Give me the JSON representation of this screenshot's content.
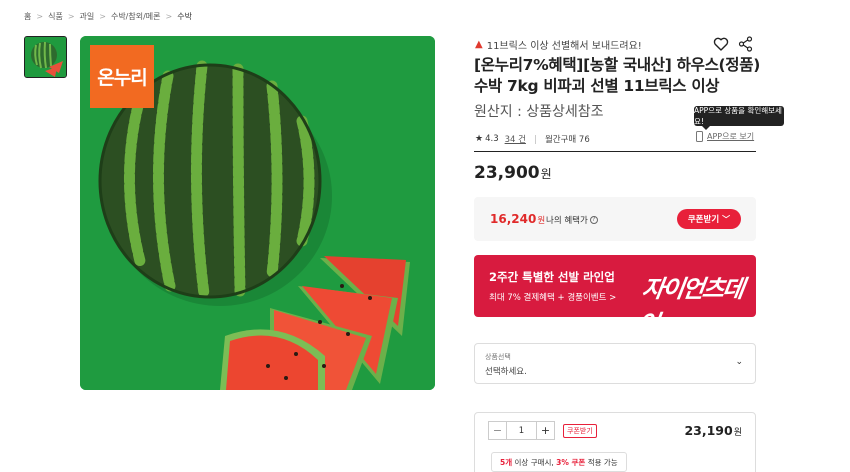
{
  "breadcrumb": [
    "홈",
    "식품",
    "과일",
    "수박/참외/메론",
    "수박"
  ],
  "breadcrumb_separator": ">",
  "image": {
    "logo_text": "온누리",
    "thumbnail_alt": "watermelon-thumbnail"
  },
  "product": {
    "promo_text": "11브릭스 이상 선별해서 보내드려요!",
    "title": "[온누리7%혜택][농할 국내산] 하우스(정품)수박 7kg 비파괴 선별 11브릭스 이상",
    "origin_label": "원산지 :",
    "origin_value": "상품상세참조",
    "rating": "4.3",
    "review_count": "34 건",
    "monthly_sales": "월간구매 76",
    "price": "23,900",
    "currency": "원"
  },
  "tooltip": "APP으로 상품을 확인해보세요!",
  "app_link": "APP으로 보기",
  "benefit": {
    "price": "16,240",
    "currency": "원",
    "label": "나의 혜택가",
    "help": "?",
    "coupon_button": "쿠폰받기",
    "coupon_chevron": "﹀"
  },
  "banner": {
    "title": "2주간 특별한 선발 라인업",
    "subtitle": "최대 7% 결제혜택 + 경품이벤트 >",
    "brand": "자이언츠데이"
  },
  "option_select": {
    "label": "상품선택",
    "value": "선택하세요.",
    "chevron": "⌄"
  },
  "quantity": {
    "minus": "−",
    "value": "1",
    "plus": "+",
    "coupon_tag": "쿠폰받기",
    "price": "23,190",
    "currency": "원",
    "bulk_qty": "5개",
    "bulk_mid": " 이상 구매시, ",
    "bulk_pct": "3% 쿠폰",
    "bulk_end": " 적용 가능"
  },
  "colors": {
    "accent_red": "#e8203a",
    "banner_red": "#d81b3f",
    "image_green": "#1e9a3f",
    "logo_orange": "#f26a21"
  }
}
